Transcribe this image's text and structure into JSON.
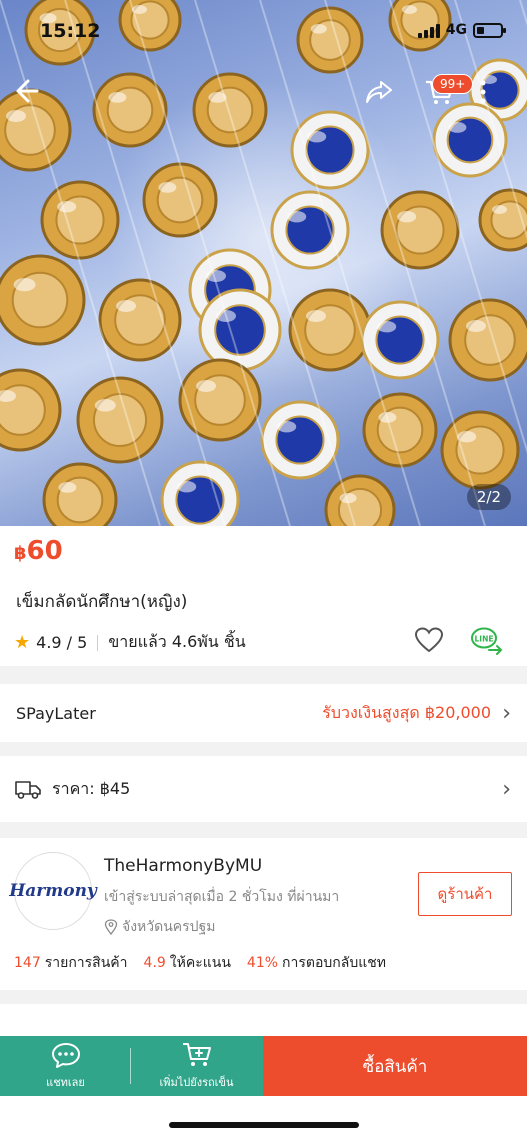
{
  "status_bar": {
    "time": "15:12",
    "network": "4G",
    "battery_level": 0.3
  },
  "header": {
    "back_icon": "back-arrow-icon",
    "share_icon": "share-icon",
    "cart_icon": "cart-icon",
    "cart_badge": "99+",
    "more_icon": "more-vertical-icon"
  },
  "gallery": {
    "counter": "2/2"
  },
  "product": {
    "currency": "฿",
    "price": "60",
    "title": "เข็มกลัดนักศึกษา(หญิง)",
    "rating": "4.9 / 5",
    "sold": "ขายแล้ว 4.6พัน ชิ้น",
    "favorite_icon": "heart-icon",
    "line_share_icon": "line-share-icon"
  },
  "spaylater": {
    "label": "SPayLater",
    "promo": "รับวงเงินสูงสุด ฿20,000"
  },
  "shipping": {
    "label": "ราคา: ฿45",
    "icon": "truck-icon"
  },
  "shop": {
    "logo_text": "Harmony",
    "name": "TheHarmonyByMU",
    "active": "เข้าสู่ระบบล่าสุดเมื่อ 2 ชั่วโมง ที่ผ่านมา",
    "location": "จังหวัดนครปฐม",
    "view_button": "ดูร้านค้า",
    "stats": [
      {
        "value": "147",
        "label": "รายการสินค้า"
      },
      {
        "value": "4.9",
        "label": "ให้คะแนน"
      },
      {
        "value": "41%",
        "label": "การตอบกลับแชท"
      }
    ]
  },
  "bottom_bar": {
    "chat_label": "แชทเลย",
    "add_cart_label": "เพิ่มไปยังรถเข็น",
    "buy_label": "ซื้อสินค้า"
  },
  "colors": {
    "accent": "#ee4d2d",
    "chat_green": "#30a58a"
  }
}
